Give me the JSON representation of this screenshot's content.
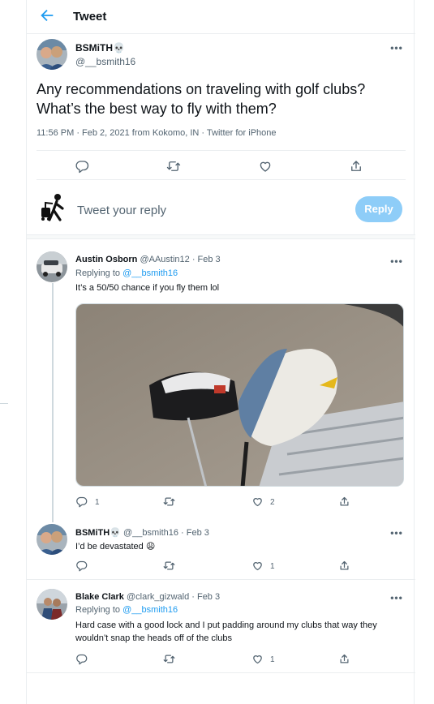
{
  "header": {
    "title": "Tweet"
  },
  "main_tweet": {
    "display_name": "BSMiTH",
    "name_emoji": "💀",
    "handle": "@__bsmith16",
    "text": "Any recommendations on traveling with golf clubs? What’s the best way to fly with them?",
    "meta": "11:56 PM · Feb 2, 2021 from Kokomo, IN · Twitter for iPhone",
    "actions": [
      "reply-icon",
      "retweet-icon",
      "like-icon",
      "share-icon"
    ]
  },
  "composer": {
    "placeholder": "Tweet your reply",
    "button_label": "Reply",
    "button_color": "#8ecdf8"
  },
  "replies": [
    {
      "name": "Austin Osborn",
      "handle_date": "@AAustin12 · Feb 3",
      "replying_prefix": "Replying to",
      "replying_to": "@__bsmith16",
      "text": "It’s a 50/50 chance if you fly them lol",
      "has_photo": true,
      "reply_count": "1",
      "retweet_count": "",
      "like_count": "2"
    },
    {
      "name": "BSMiTH",
      "name_emoji": "💀",
      "handle_date": "@__bsmith16 · Feb 3",
      "text": "I’d be devastated 😩",
      "reply_count": "",
      "retweet_count": "",
      "like_count": "1"
    },
    {
      "name": "Blake Clark",
      "handle_date": "@clark_gizwald · Feb 3",
      "replying_prefix": "Replying to",
      "replying_to": "@__bsmith16",
      "text": "Hard case with a good lock and I put padding around my clubs that way they wouldn’t snap the heads off of the clubs",
      "reply_count": "",
      "retweet_count": "",
      "like_count": "1"
    }
  ],
  "colors": {
    "accent": "#1d9bf0",
    "secondary_text": "#536471",
    "border": "#ebeef0"
  }
}
